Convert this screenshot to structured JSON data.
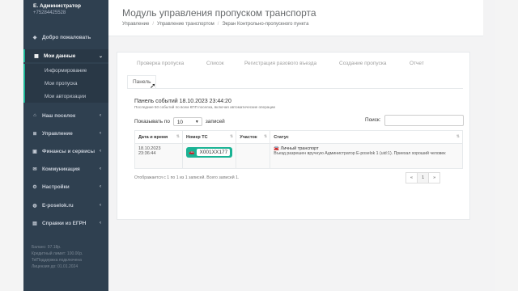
{
  "sidebar": {
    "user_name": "Е. Администратор",
    "user_phone": "+75284425528",
    "items": [
      {
        "icon": "diamond-icon",
        "label": "Добро пожаловать",
        "glyph": "◆",
        "chevron": ""
      },
      {
        "icon": "table-icon",
        "label": "Мои данные",
        "glyph": "▦",
        "chevron": "⌄"
      },
      {
        "icon": "home-icon",
        "label": "Наш поселок",
        "glyph": "⌂",
        "chevron": "‹"
      },
      {
        "icon": "list-icon",
        "label": "Управление",
        "glyph": "≣",
        "chevron": "‹"
      },
      {
        "icon": "money-icon",
        "label": "Финансы и сервисы",
        "glyph": "▣",
        "chevron": "‹"
      },
      {
        "icon": "chat-icon",
        "label": "Коммуникация",
        "glyph": "✉",
        "chevron": "‹"
      },
      {
        "icon": "gear-icon",
        "label": "Настройки",
        "glyph": "⚙",
        "chevron": "‹"
      },
      {
        "icon": "globe-icon",
        "label": "E-poselok.ru",
        "glyph": "◍",
        "chevron": "‹"
      },
      {
        "icon": "document-icon",
        "label": "Справки из ЕГРН",
        "glyph": "▤",
        "chevron": "‹"
      }
    ],
    "subitems": [
      "Информирование",
      "Мои пропуска",
      "Мои авторизации"
    ],
    "footer": [
      "Баланс: 97.18р.",
      "Кредитный лимит: 100.00р.",
      "TelПоддержка подключена",
      "Лицензия до: 01.01.2024"
    ]
  },
  "header": {
    "title": "Модуль управления пропуском транспорта",
    "breadcrumb": [
      "Управление",
      "Управление транспортом",
      "Экран Контрольно-пропускного пункта"
    ]
  },
  "tabs": [
    "Проверка пропуска",
    "Список",
    "Регистрация разового въезда",
    "Создание пропуска",
    "Отчет"
  ],
  "sub_tab": "Панель",
  "panel": {
    "title": "Панель событий 18.10.2023 23:44:20",
    "subtitle": "Последние 50 событий по всем КПП поселка, включая автоматические операции",
    "show_prefix": "Показывать по",
    "show_value": "10",
    "show_suffix": "записей",
    "search_label": "Поиск:"
  },
  "table": {
    "columns": [
      "Дата и время",
      "Номер ТС",
      "Участок",
      "Статус"
    ],
    "rows": [
      {
        "date": "18.10.2023",
        "time": "23:36:44",
        "plate": "X001XX177",
        "plot": "",
        "status_title": "Личный транспорт",
        "status_text": "Въезд разрешен вручную Администратор E-poselok 1 (uid:1). Приехал хороший человек"
      }
    ]
  },
  "footer_info": "Отображается с 1 по 1 из 1 записей. Всего записей 1.",
  "pager": [
    "«",
    "1",
    "»"
  ]
}
